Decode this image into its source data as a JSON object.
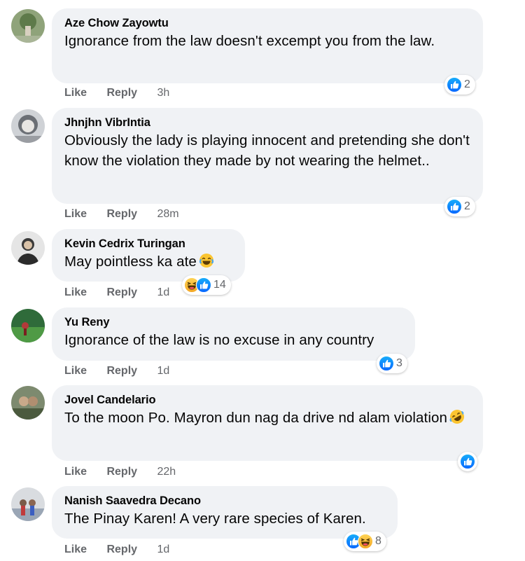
{
  "actions": {
    "like": "Like",
    "reply": "Reply"
  },
  "comments": [
    {
      "author": "Aze Chow Zayowtu",
      "text": "Ignorance from the law doesn't excempt you from the law.",
      "time": "3h",
      "reaction_count": "2",
      "reactions": [
        "like-icon"
      ]
    },
    {
      "author": "Jhnjhn VibrIntia",
      "text": "Obviously the lady is playing innocent and pretending she don't know the violation they made by not wearing the helmet..",
      "time": "28m",
      "reaction_count": "2",
      "reactions": [
        "like-icon"
      ]
    },
    {
      "author": "Kevin Cedrix Turingan",
      "text": "May pointless ka ate",
      "inline_emoji": "laughing-emoji",
      "time": "1d",
      "reaction_count": "14",
      "reactions": [
        "haha-icon",
        "like-icon"
      ]
    },
    {
      "author": "Yu Reny",
      "text": "Ignorance of the law is no excuse in any country",
      "time": "1d",
      "reaction_count": "3",
      "reactions": [
        "like-icon"
      ]
    },
    {
      "author": "Jovel Candelario",
      "text": "To the moon Po. Mayron dun nag da drive nd alam violation",
      "inline_emoji": "rolling-laugh-emoji",
      "time": "22h",
      "reaction_count": "",
      "reactions": [
        "like-icon"
      ]
    },
    {
      "author": "Nanish Saavedra Decano",
      "text": "The Pinay Karen! A very rare species of Karen.",
      "time": "1d",
      "reaction_count": "8",
      "reactions": [
        "like-icon",
        "haha-icon"
      ]
    }
  ],
  "colors": {
    "bubble": "#f0f2f5",
    "like_blue": "#1877f2",
    "meta_gray": "#65676b",
    "haha_yellow": "#f7b928"
  }
}
